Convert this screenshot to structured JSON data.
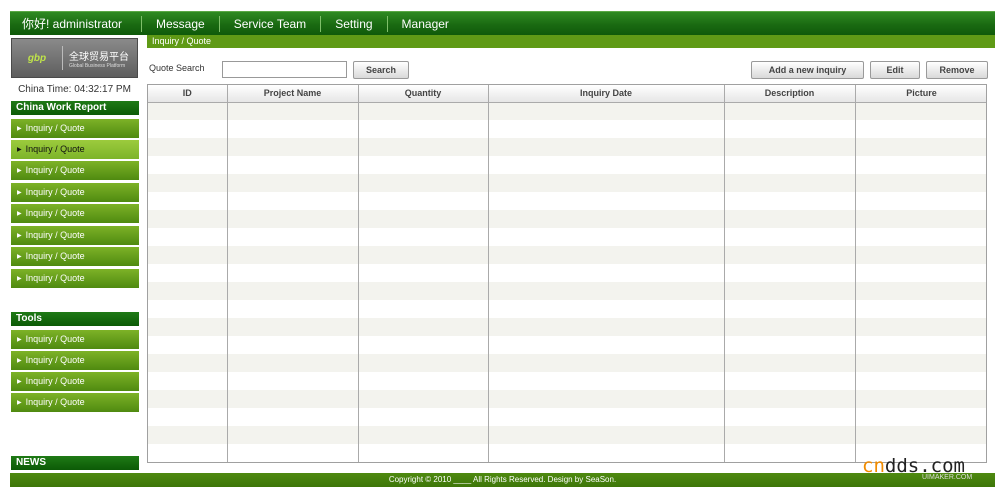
{
  "topnav": {
    "greeting": "你好! administrator",
    "items": [
      "Message",
      "Service Team",
      "Setting",
      "Manager"
    ]
  },
  "logo": {
    "mark": "gbp",
    "cn": "全球贸易平台",
    "en": "Global Business Platform"
  },
  "clock": "China Time: 04:32:17 PM",
  "sidebar": {
    "work_report": {
      "title": "China Work Report",
      "items": [
        "Inquiry / Quote",
        "Inquiry / Quote",
        "Inquiry / Quote",
        "Inquiry / Quote",
        "Inquiry / Quote",
        "Inquiry / Quote",
        "Inquiry / Quote",
        "Inquiry / Quote"
      ]
    },
    "tools": {
      "title": "Tools",
      "items": [
        "Inquiry / Quote",
        "Inquiry / Quote",
        "Inquiry / Quote",
        "Inquiry / Quote"
      ]
    },
    "news": {
      "title": "NEWS"
    }
  },
  "breadcrumb": "Inquiry / Quote",
  "search": {
    "label": "Quote  Search",
    "value": "",
    "button": "Search"
  },
  "toolbar": {
    "add_label": "Add a new inquiry",
    "edit_label": "Edit",
    "remove_label": "Remove"
  },
  "table": {
    "columns": [
      "ID",
      "Project Name",
      "Quantity",
      "Inquiry Date",
      "Description",
      "Picture"
    ],
    "rows": []
  },
  "footer": "Copyright © 2010 ____ All Rights Reserved. Design by SeaSon.",
  "watermark": {
    "part1": "cn",
    "part2": "dds.com",
    "sub": "UIMAKER.COM"
  },
  "colors": {
    "nav_green": "#1a6a12",
    "menu_green": "#5f9a16",
    "accent_orange": "#f28c00"
  }
}
